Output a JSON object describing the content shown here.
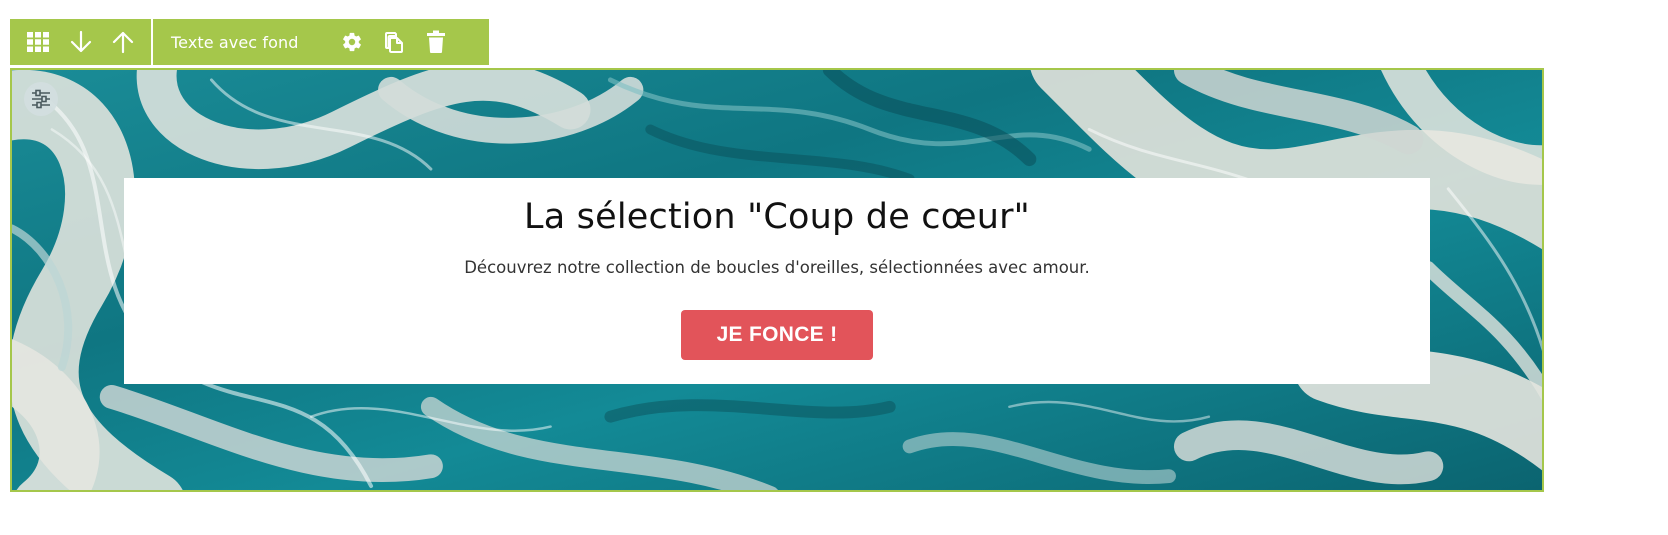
{
  "colors": {
    "accent": "#a5c74b",
    "cta_background": "#e2545a",
    "teal_dark": "#0b6f7c",
    "teal_mid": "#15919c",
    "marble_light": "#d9ddd8"
  },
  "toolbar": {
    "nav_icons": [
      "grid-icon",
      "arrow-down-icon",
      "arrow-up-icon"
    ],
    "block_title": "Texte avec fond",
    "action_icons": [
      "gear-icon",
      "duplicate-icon",
      "trash-icon"
    ]
  },
  "section": {
    "background": "teal-marble-swirl-image",
    "settings_icon": "sliders-icon",
    "title": "La sélection \"Coup de cœur\"",
    "subtitle": "Découvrez notre collection de boucles d'oreilles, sélectionnées avec amour.",
    "cta_label": "JE FONCE !"
  }
}
